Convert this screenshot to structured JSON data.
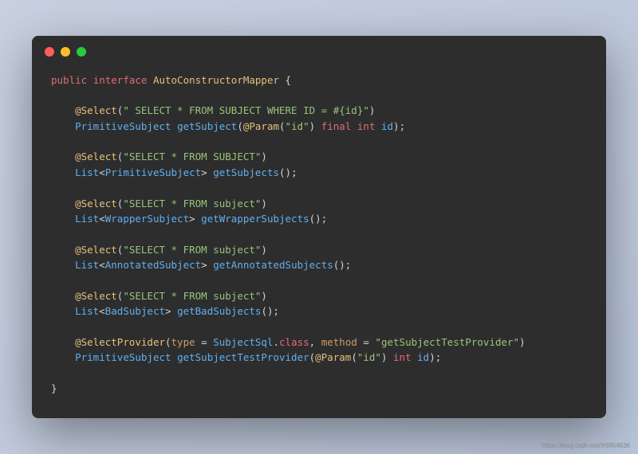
{
  "code": {
    "line1": {
      "kw1": "public",
      "kw2": "interface",
      "name": "AutoConstructorMapper",
      "brace": " {"
    },
    "block1": {
      "anno": "@Select",
      "str": "\" SELECT * FROM SUBJECT WHERE ID = #{id}\"",
      "type": "PrimitiveSubject",
      "method": "getSubject",
      "paramAnno": "@Param",
      "paramStr": "\"id\"",
      "kwFinal": "final",
      "kwInt": "int",
      "paramName": "id"
    },
    "block2": {
      "anno": "@Select",
      "str": "\"SELECT * FROM SUBJECT\"",
      "type1": "List",
      "type2": "PrimitiveSubject",
      "method": "getSubjects"
    },
    "block3": {
      "anno": "@Select",
      "str": "\"SELECT * FROM subject\"",
      "type1": "List",
      "type2": "WrapperSubject",
      "method": "getWrapperSubjects"
    },
    "block4": {
      "anno": "@Select",
      "str": "\"SELECT * FROM subject\"",
      "type1": "List",
      "type2": "AnnotatedSubject",
      "method": "getAnnotatedSubjects"
    },
    "block5": {
      "anno": "@Select",
      "str": "\"SELECT * FROM subject\"",
      "type1": "List",
      "type2": "BadSubject",
      "method": "getBadSubjects"
    },
    "block6": {
      "anno": "@SelectProvider",
      "propType": "type",
      "val1": "SubjectSql",
      "cls": "class",
      "propMethod": "method",
      "str": "\"getSubjectTestProvider\"",
      "retType": "PrimitiveSubject",
      "method": "getSubjectTestProvider",
      "paramAnno": "@Param",
      "paramStr": "\"id\"",
      "kwInt": "int",
      "paramName": "id"
    },
    "closeBrace": "}"
  },
  "watermark": "https://blog.csdn.net/X6954636"
}
